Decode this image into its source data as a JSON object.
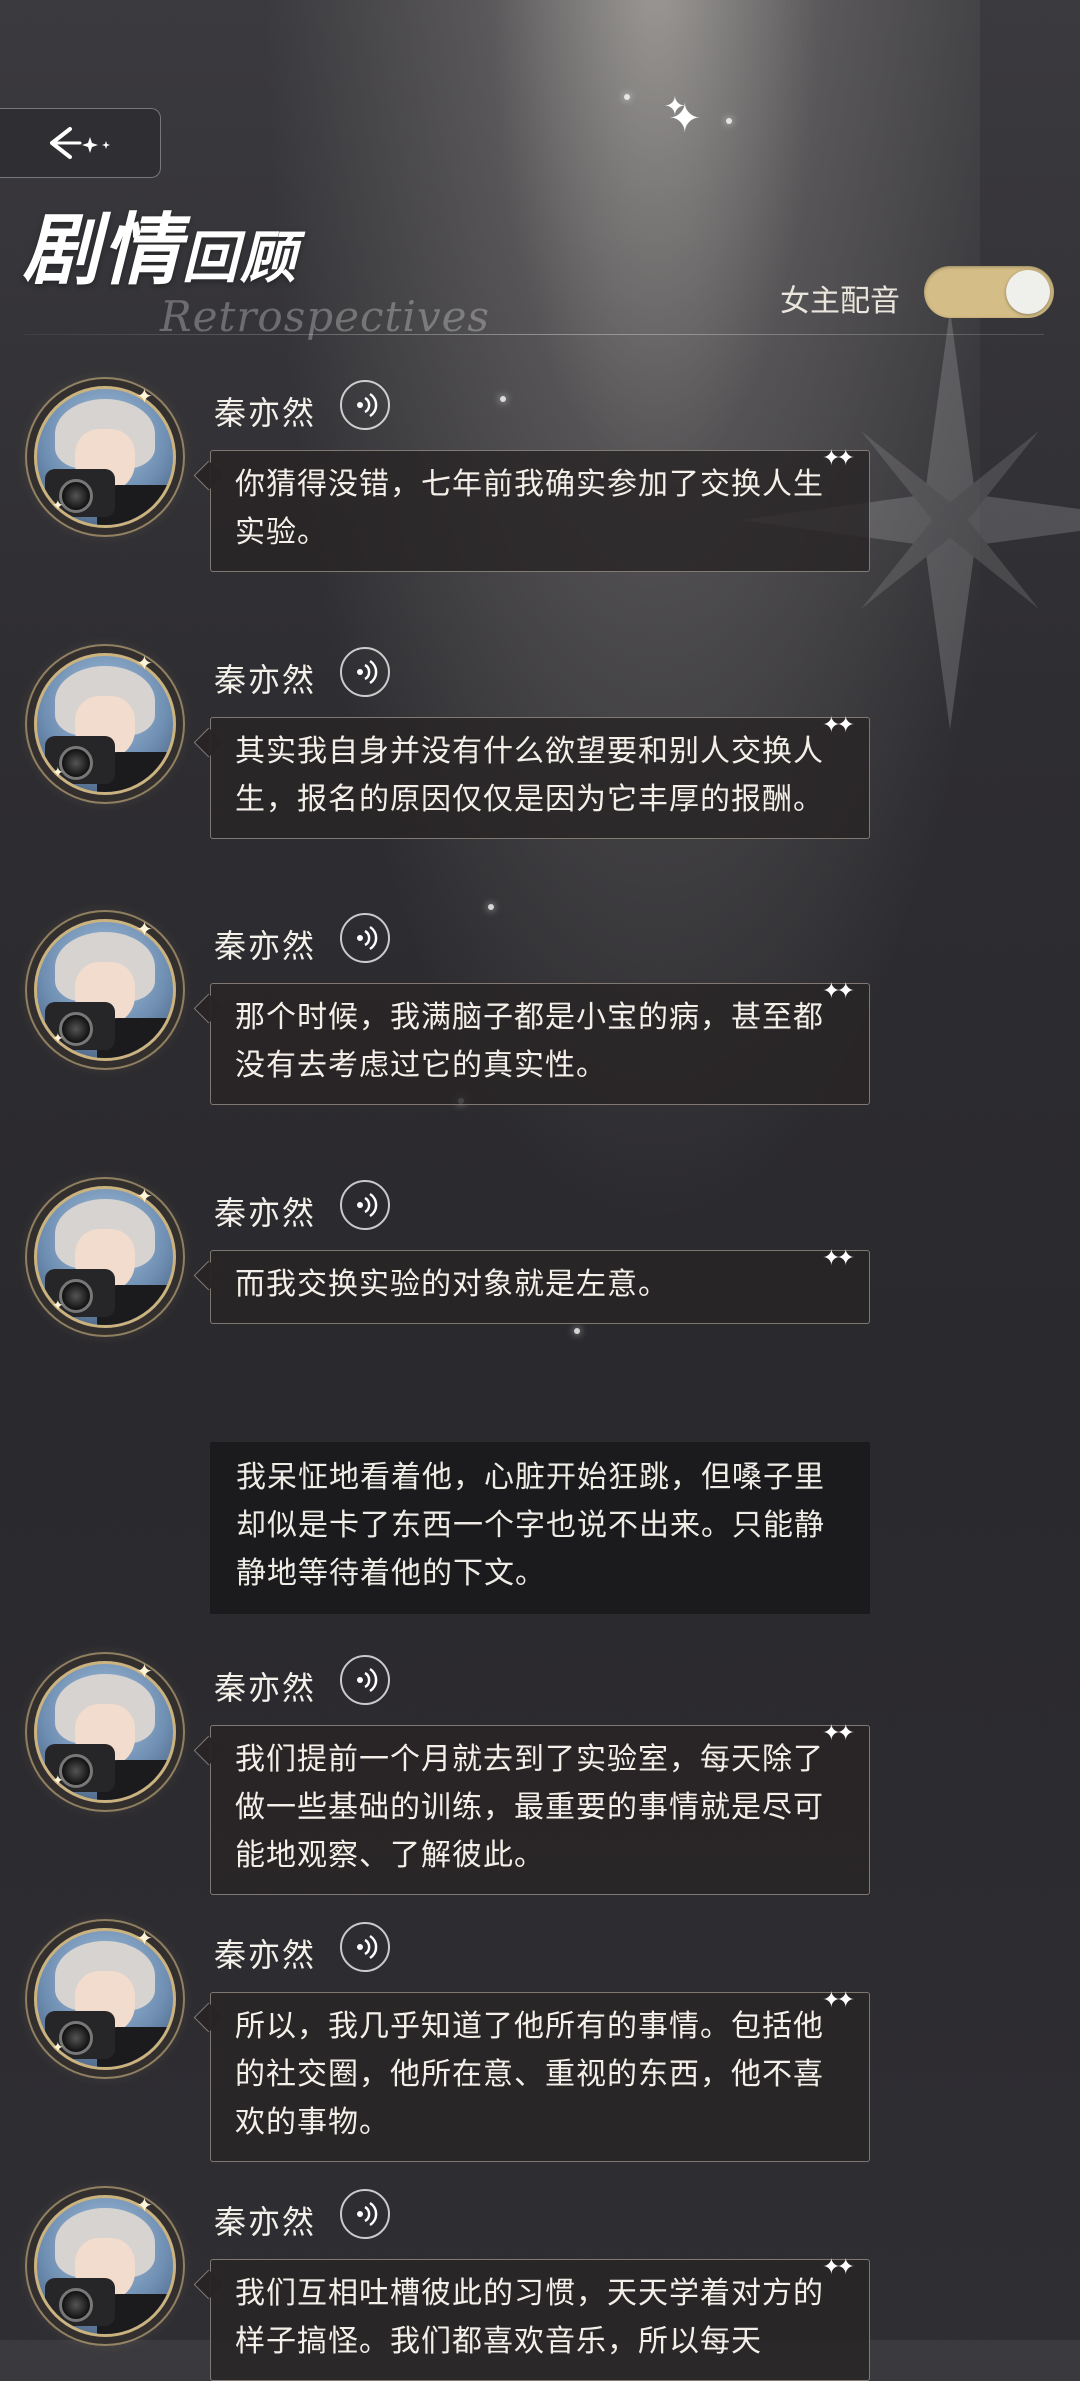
{
  "header": {
    "back_icon": "back-arrow-icon",
    "title_main": "剧情",
    "title_small": "回顾",
    "subtitle": "Retrospectives",
    "voice_toggle_label": "女主配音",
    "voice_toggle_on": true,
    "accent_color": "#d4bd86"
  },
  "dialogues": [
    {
      "speaker": "秦亦然",
      "text": "你猜得没错，七年前我确实参加了交换人生实验。"
    },
    {
      "speaker": "秦亦然",
      "text": "其实我自身并没有什么欲望要和别人交换人生，报名的原因仅仅是因为它丰厚的报酬。"
    },
    {
      "speaker": "秦亦然",
      "text": "那个时候，我满脑子都是小宝的病，甚至都没有去考虑过它的真实性。"
    },
    {
      "speaker": "秦亦然",
      "text": "而我交换实验的对象就是左意。"
    },
    {
      "speaker": "秦亦然",
      "text": "我们提前一个月就去到了实验室，每天除了做一些基础的训练，最重要的事情就是尽可能地观察、了解彼此。"
    },
    {
      "speaker": "秦亦然",
      "text": "所以，我几乎知道了他所有的事情。包括他的社交圈，他所在意、重视的东西，他不喜欢的事物。"
    },
    {
      "speaker": "秦亦然",
      "text": "我们互相吐槽彼此的习惯，天天学着对方的样子搞怪。我们都喜欢音乐，所以每天"
    }
  ],
  "narration": {
    "text": "我呆怔地看着他，心脏开始狂跳，但嗓子里却似是卡了东西一个字也说不出来。只能静静地等待着他的下文。"
  }
}
